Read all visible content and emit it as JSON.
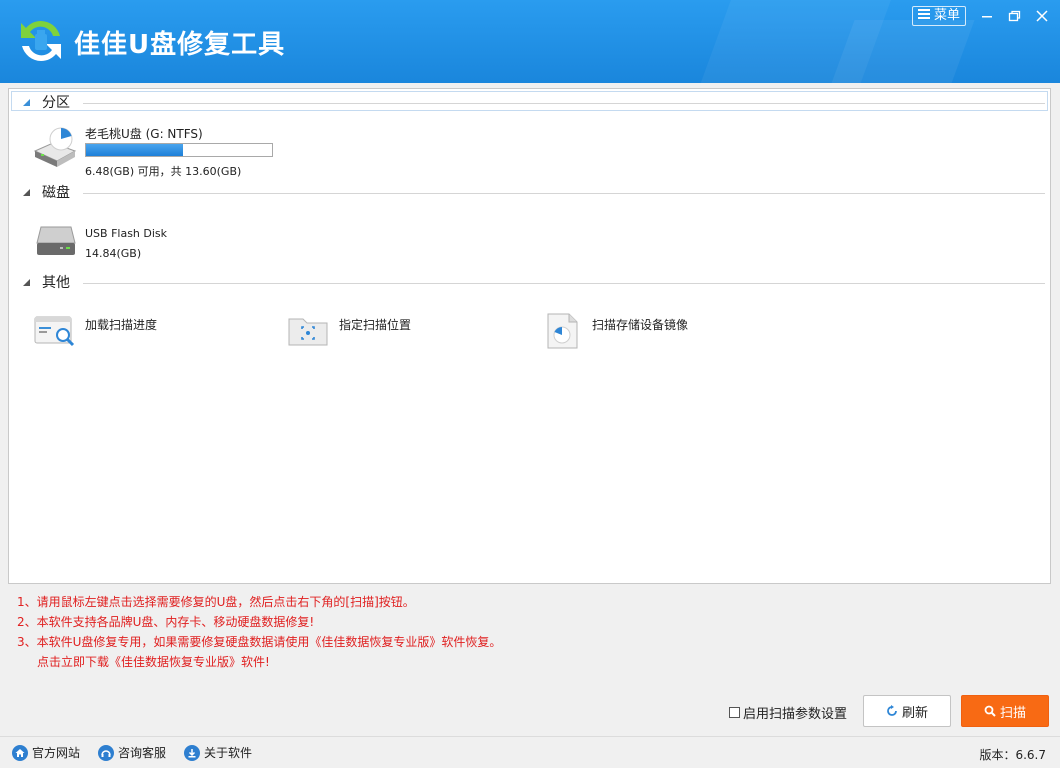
{
  "app": {
    "title": "佳佳U盘修复工具",
    "menu_label": "菜单"
  },
  "sections": {
    "partition": {
      "label": "分区"
    },
    "disk": {
      "label": "磁盘"
    },
    "other": {
      "label": "其他"
    }
  },
  "partition_item": {
    "name": "老毛桃U盘 (G: NTFS)",
    "usage": "6.48(GB) 可用，共 13.60(GB)",
    "used_fraction": 0.52
  },
  "disk_item": {
    "name": "USB Flash Disk",
    "size": "14.84(GB)"
  },
  "other_items": {
    "load_progress": "加载扫描进度",
    "specify_location": "指定扫描位置",
    "scan_image": "扫描存储设备镜像"
  },
  "notes": {
    "line1": "1、请用鼠标左键点击选择需要修复的U盘，然后点击右下角的[扫描]按钮。",
    "line2": "2、本软件支持各品牌U盘、内存卡、移动硬盘数据修复!",
    "line3": "3、本软件U盘修复专用，如果需要修复硬盘数据请使用《佳佳数据恢复专业版》软件恢复。",
    "line4": "点击立即下载《佳佳数据恢复专业版》软件!"
  },
  "controls": {
    "scan_params_label": "启用扫描参数设置",
    "refresh_label": "刷新",
    "scan_label": "扫描"
  },
  "status": {
    "website": "官方网站",
    "support": "咨询客服",
    "about": "关于软件",
    "version": "版本：6.6.7"
  },
  "colors": {
    "title_bar": "#1e8fe0",
    "scan_button": "#f86a14",
    "notes_text": "#e02020"
  }
}
